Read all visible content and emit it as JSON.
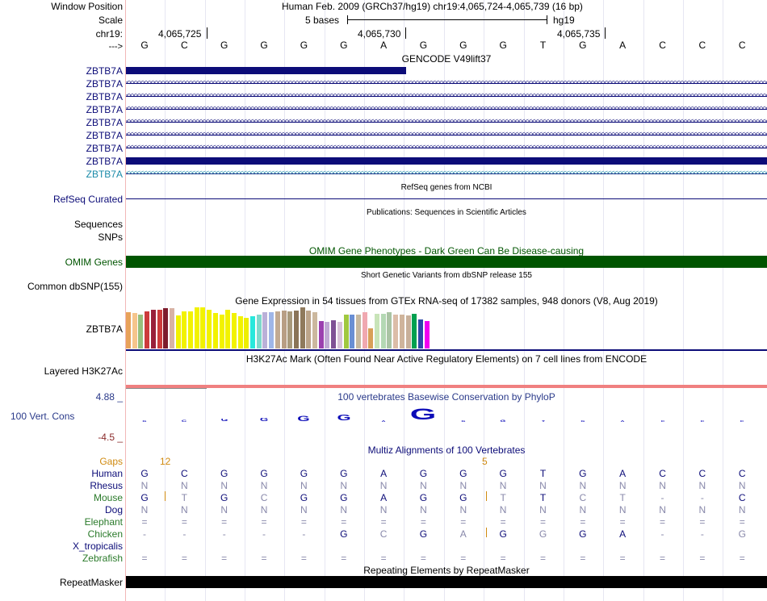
{
  "header": {
    "window_position_label": "Window Position",
    "scale_label": "Scale",
    "chrom_label": "chr19:",
    "strand_label": "--->",
    "assembly_info": "Human Feb. 2009 (GRCh37/hg19)   chr19:4,065,724-4,065,739 (16 bp)",
    "scale_text": "5 bases",
    "genome": "hg19",
    "coords": [
      "4,065,725",
      "4,065,730",
      "4,065,735"
    ]
  },
  "bases": [
    "G",
    "C",
    "G",
    "G",
    "G",
    "G",
    "A",
    "G",
    "G",
    "G",
    "T",
    "G",
    "A",
    "C",
    "C",
    "C"
  ],
  "gencode": {
    "title": "GENCODE V49lift37",
    "labels": [
      "ZBTB7A",
      "ZBTB7A",
      "ZBTB7A",
      "ZBTB7A",
      "ZBTB7A",
      "ZBTB7A",
      "ZBTB7A",
      "ZBTB7A",
      "ZBTB7A"
    ]
  },
  "refseq": {
    "title": "RefSeq genes from NCBI",
    "label": "RefSeq Curated"
  },
  "publications": {
    "title": "Publications: Sequences in Scientific Articles",
    "label": "Sequences"
  },
  "snps": {
    "label": "SNPs"
  },
  "omim": {
    "title": "OMIM Gene Phenotypes - Dark Green Can Be Disease-causing",
    "label": "OMIM Genes",
    "color": "#005500"
  },
  "dbsnp": {
    "title": "Short Genetic Variants from dbSNP release 155",
    "label": "Common dbSNP(155)"
  },
  "gtex": {
    "title": "Gene Expression in 54 tissues from GTEx RNA-seq of 17382 samples, 948 donors (V8, Aug 2019)",
    "label": "ZBTB7A",
    "bars": [
      {
        "v": 0.87,
        "c": "#e8a25a"
      },
      {
        "v": 0.84,
        "c": "#f6c58c"
      },
      {
        "v": 0.8,
        "c": "#98c07c"
      },
      {
        "v": 0.88,
        "c": "#cc3b3b"
      },
      {
        "v": 0.93,
        "c": "#99203a"
      },
      {
        "v": 0.92,
        "c": "#cc3b3b"
      },
      {
        "v": 0.96,
        "c": "#7d1b2c"
      },
      {
        "v": 0.96,
        "c": "#d8b3a4"
      },
      {
        "v": 0.78,
        "c": "#f2f200"
      },
      {
        "v": 0.88,
        "c": "#f2f200"
      },
      {
        "v": 0.88,
        "c": "#f2f200"
      },
      {
        "v": 0.99,
        "c": "#f2f200"
      },
      {
        "v": 0.99,
        "c": "#f2f200"
      },
      {
        "v": 0.93,
        "c": "#f2f200"
      },
      {
        "v": 0.85,
        "c": "#f2f200"
      },
      {
        "v": 0.81,
        "c": "#f2f200"
      },
      {
        "v": 0.92,
        "c": "#f2f200"
      },
      {
        "v": 0.85,
        "c": "#f2f200"
      },
      {
        "v": 0.76,
        "c": "#f2f200"
      },
      {
        "v": 0.73,
        "c": "#eeee00"
      },
      {
        "v": 0.77,
        "c": "#28e8dc"
      },
      {
        "v": 0.8,
        "c": "#7fd8cc"
      },
      {
        "v": 0.86,
        "c": "#bab0d8"
      },
      {
        "v": 0.87,
        "c": "#9fb6e8"
      },
      {
        "v": 0.89,
        "c": "#c2aa92"
      },
      {
        "v": 0.91,
        "c": "#b89e84"
      },
      {
        "v": 0.89,
        "c": "#a8997b"
      },
      {
        "v": 0.9,
        "c": "#8a7458"
      },
      {
        "v": 0.98,
        "c": "#8f7a5c"
      },
      {
        "v": 0.91,
        "c": "#bca58a"
      },
      {
        "v": 0.87,
        "c": "#ccb89e"
      },
      {
        "v": 0.65,
        "c": "#9b3faf"
      },
      {
        "v": 0.63,
        "c": "#c0a8d4"
      },
      {
        "v": 0.67,
        "c": "#7f5095"
      },
      {
        "v": 0.64,
        "c": "#d8c2d8"
      },
      {
        "v": 0.8,
        "c": "#a0c840"
      },
      {
        "v": 0.8,
        "c": "#6a8fd4"
      },
      {
        "v": 0.8,
        "c": "#c7b9a0"
      },
      {
        "v": 0.86,
        "c": "#f0a8b0"
      },
      {
        "v": 0.49,
        "c": "#d8a058"
      },
      {
        "v": 0.82,
        "c": "#c8e4b8"
      },
      {
        "v": 0.83,
        "c": "#b4d8b4"
      },
      {
        "v": 0.86,
        "c": "#aac4a4"
      },
      {
        "v": 0.81,
        "c": "#dcbda8"
      },
      {
        "v": 0.81,
        "c": "#cfb49c"
      },
      {
        "v": 0.78,
        "c": "#c8b09a"
      },
      {
        "v": 0.83,
        "c": "#00a050"
      },
      {
        "v": 0.69,
        "c": "#2e48a8"
      },
      {
        "v": 0.65,
        "c": "#f000f0"
      }
    ]
  },
  "h3k27ac": {
    "title": "H3K27Ac Mark (Often Found Near Active Regulatory Elements) on 7 cell lines from ENCODE",
    "label": "Layered H3K27Ac"
  },
  "conservation": {
    "title": "100 vertebrates Basewise Conservation by PhyloP",
    "label": "100 Vert. Cons",
    "max_label": "4.88 _",
    "min_label": "-4.5 _",
    "scores": [
      0.3,
      0.6,
      0.8,
      1.0,
      1.5,
      1.6,
      0.5,
      3.2,
      0.3,
      0.6,
      0.4,
      0.5,
      0.3,
      0.2,
      0.15,
      0.1
    ]
  },
  "multiz": {
    "title": "Multiz Alignments of 100 Vertebrates",
    "gaps_label": "Gaps",
    "gaps": [
      "12",
      "5"
    ],
    "species": [
      {
        "name": "Human",
        "color": "#0c0c78",
        "row": [
          "G",
          "C",
          "G",
          "G",
          "G",
          "G",
          "A",
          "G",
          "G",
          "G",
          "T",
          "G",
          "A",
          "C",
          "C",
          "C"
        ],
        "rowColor": "#0c0c78"
      },
      {
        "name": "Rhesus",
        "color": "#0c0c78",
        "row": [
          "N",
          "N",
          "N",
          "N",
          "N",
          "N",
          "N",
          "N",
          "N",
          "N",
          "N",
          "N",
          "N",
          "N",
          "N",
          "N"
        ],
        "rowColor": "#8888aa"
      },
      {
        "name": "Mouse",
        "color": "#2a7a2a",
        "row": [
          "G",
          "T",
          "G",
          "C",
          "G",
          "G",
          "A",
          "G",
          "G",
          "T",
          "T",
          "C",
          "T",
          "-",
          "-",
          "C"
        ],
        "rowColor": "#0c0c78"
      },
      {
        "name": "Dog",
        "color": "#0c0c78",
        "row": [
          "N",
          "N",
          "N",
          "N",
          "N",
          "N",
          "N",
          "N",
          "N",
          "N",
          "N",
          "N",
          "N",
          "N",
          "N",
          "N"
        ],
        "rowColor": "#8888aa"
      },
      {
        "name": "Elephant",
        "color": "#2a7a2a",
        "row": [
          "=",
          "=",
          "=",
          "=",
          "=",
          "=",
          "=",
          "=",
          "=",
          "=",
          "=",
          "=",
          "=",
          "=",
          "=",
          "="
        ],
        "rowColor": "#8888aa"
      },
      {
        "name": "Chicken",
        "color": "#2a7a2a",
        "row": [
          "-",
          "-",
          "-",
          "-",
          "-",
          "G",
          "C",
          "G",
          "A",
          "G",
          "G",
          "G",
          "A",
          "-",
          "-",
          "G"
        ],
        "rowColor": "#0c0c78"
      },
      {
        "name": "X_tropicalis",
        "color": "#0c0c78",
        "row": [
          "",
          "",
          "",
          "",
          "",
          "",
          "",
          "",
          "",
          "",
          "",
          "",
          "",
          "",
          "",
          ""
        ],
        "rowColor": "#8888aa"
      },
      {
        "name": "Zebrafish",
        "color": "#2a7a2a",
        "row": [
          "=",
          "=",
          "=",
          "=",
          "=",
          "=",
          "=",
          "=",
          "=",
          "=",
          "=",
          "=",
          "=",
          "=",
          "=",
          "="
        ],
        "rowColor": "#8888aa"
      }
    ]
  },
  "repeatmasker": {
    "title": "Repeating Elements by RepeatMasker",
    "label": "RepeatMasker"
  }
}
